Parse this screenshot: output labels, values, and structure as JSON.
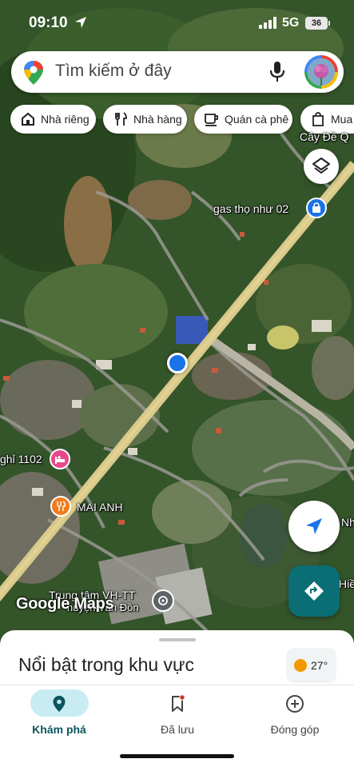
{
  "status_bar": {
    "time": "09:10",
    "network": "5G",
    "battery": "36"
  },
  "search": {
    "placeholder": "Tìm kiếm ở đây"
  },
  "chips": [
    {
      "label": "Nhà riêng",
      "icon": "home-icon"
    },
    {
      "label": "Nhà hàng",
      "icon": "restaurant-icon"
    },
    {
      "label": "Quán cà phê",
      "icon": "cafe-icon"
    },
    {
      "label": "Mua s",
      "icon": "shopping-icon"
    }
  ],
  "map": {
    "labels": {
      "cay_de": "Cây Đề Q",
      "gas": "gas thọ như 02",
      "nghi": "ghỉ 1102",
      "mai_anh": "MAI ANH",
      "trung_tam_1": "Trung tâm VH-TT",
      "trung_tam_2": "huyện Vân Đồn",
      "nh": "Nh",
      "hie": "Hiề"
    },
    "attribution": "Google Maps"
  },
  "sheet": {
    "title": "Nổi bật trong khu vực",
    "temperature": "27°"
  },
  "nav": {
    "explore": "Khám phá",
    "saved": "Đã lưu",
    "contribute": "Đóng góp"
  },
  "colors": {
    "accent": "#1a73e8",
    "explore_pill": "#c9ecf3",
    "directions": "#0b6e74",
    "road": "#d9c98a"
  }
}
